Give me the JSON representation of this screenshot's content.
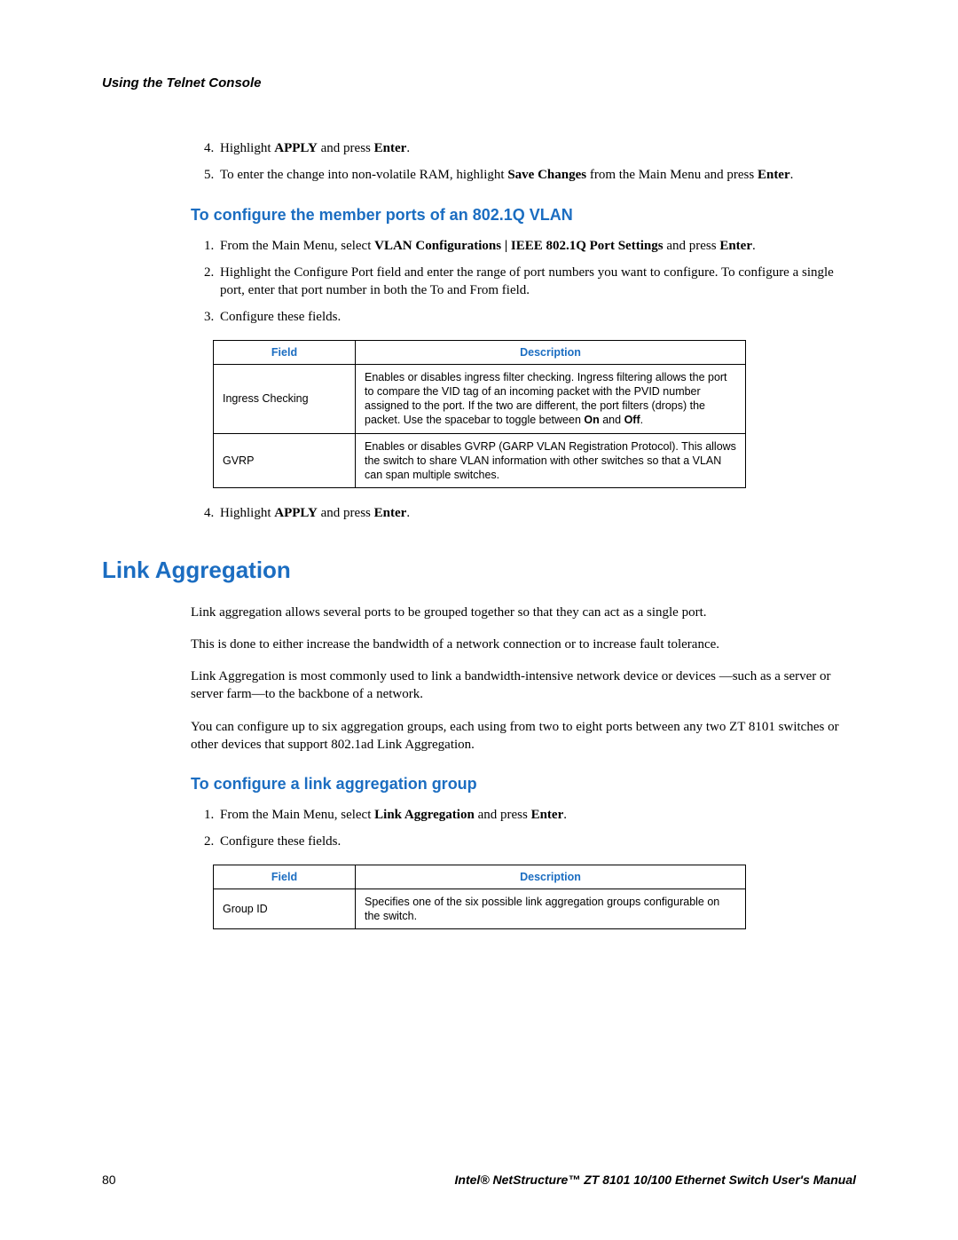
{
  "header": "Using the Telnet Console",
  "list1": {
    "item4_pre": "Highlight ",
    "item4_b1": "APPLY",
    "item4_mid": " and press ",
    "item4_b2": "Enter",
    "item4_suf": ".",
    "item5_pre": "To enter the change into non-volatile RAM, highlight ",
    "item5_b1": "Save Changes",
    "item5_mid": " from the Main Menu and press ",
    "item5_b2": "Enter",
    "item5_suf": "."
  },
  "h2_1": "To configure the member ports of an 802.1Q VLAN",
  "list2": {
    "item1_pre": "From the Main Menu, select ",
    "item1_b1": "VLAN Configurations | IEEE 802.1Q Port Settings",
    "item1_mid": " and press ",
    "item1_b2": "Enter",
    "item1_suf": ".",
    "item2": "Highlight the Configure Port field and enter the range of port numbers you want to configure. To configure a single port, enter that port number in both the To and From field.",
    "item3": "Configure these fields."
  },
  "table1": {
    "h_field": "Field",
    "h_desc": "Description",
    "r1_field": "Ingress Checking",
    "r1_desc_pre": "Enables or disables ingress filter checking. Ingress filtering allows the port to compare the VID tag of an incoming packet with the PVID number assigned to the port. If the two are different, the port filters (drops) the packet. Use the spacebar to toggle between ",
    "r1_desc_b1": "On",
    "r1_desc_mid": " and ",
    "r1_desc_b2": "Off",
    "r1_desc_suf": ".",
    "r2_field": "GVRP",
    "r2_desc": "Enables or disables GVRP (GARP VLAN Registration Protocol). This allows the switch to share VLAN information with other switches so that a VLAN can span multiple switches."
  },
  "list3": {
    "item4_pre": "Highlight ",
    "item4_b1": "APPLY",
    "item4_mid": " and press ",
    "item4_b2": "Enter",
    "item4_suf": "."
  },
  "h1": "Link Aggregation",
  "paras": {
    "p1": "Link aggregation allows several ports to be grouped together so that they can act as a single port.",
    "p2": "This is done to either increase the bandwidth of a network connection or to increase fault tolerance.",
    "p3": "Link Aggregation is most commonly used to link a bandwidth-intensive network device or devices —such as a server or server farm—to the backbone of a network.",
    "p4": "You can configure up to six aggregation groups, each using from two to eight ports between any two ZT 8101 switches or other devices that support 802.1ad Link Aggregation."
  },
  "h2_2": "To configure a link aggregation group",
  "list4": {
    "item1_pre": "From the Main Menu, select ",
    "item1_b1": "Link Aggregation",
    "item1_mid": " and press ",
    "item1_b2": "Enter",
    "item1_suf": ".",
    "item2": "Configure these fields."
  },
  "table2": {
    "h_field": "Field",
    "h_desc": "Description",
    "r1_field": "Group ID",
    "r1_desc": "Specifies one of the six possible link aggregation groups configurable on the switch."
  },
  "footer": {
    "page": "80",
    "title": "Intel® NetStructure™ ZT 8101 10/100 Ethernet Switch User's Manual"
  }
}
